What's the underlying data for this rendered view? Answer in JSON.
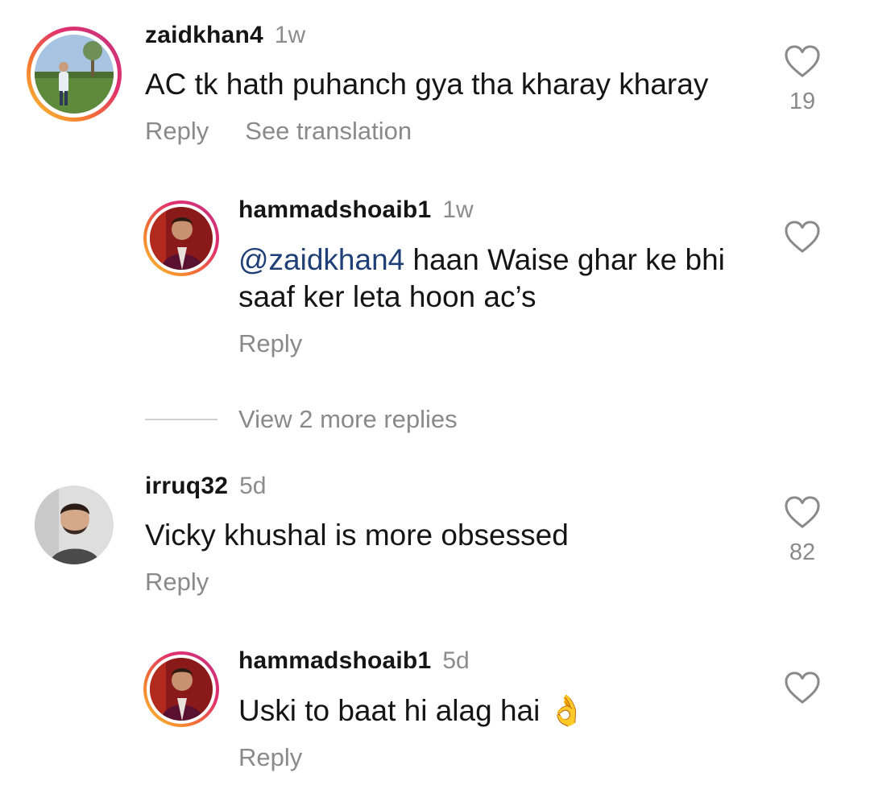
{
  "comments": [
    {
      "username": "zaidkhan4",
      "time": "1w",
      "text": "AC tk hath puhanch gya tha kharay kharay",
      "likes": "19",
      "reply_label": "Reply",
      "translate_label": "See translation"
    },
    {
      "username": "hammadshoaib1",
      "time": "1w",
      "mention": "@zaidkhan4",
      "text_line1": " haan Waise ghar ke bhi",
      "text_line2": "saaf ker leta hoon ac’s",
      "reply_label": "Reply"
    },
    {
      "view_more_label": "View 2 more replies"
    },
    {
      "username": "irruq32",
      "time": "5d",
      "text": "Vicky khushal is more obsessed",
      "likes": "82",
      "reply_label": "Reply"
    },
    {
      "username": "hammadshoaib1",
      "time": "5d",
      "text": "Uski to baat hi alag hai 👌",
      "reply_label": "Reply"
    }
  ],
  "icons": {
    "like": "heart-outline-icon"
  },
  "colors": {
    "mention": "#1f3f77",
    "muted": "#8a8a8a",
    "story_ring_start": "#fdc830",
    "story_ring_end": "#c13584"
  }
}
